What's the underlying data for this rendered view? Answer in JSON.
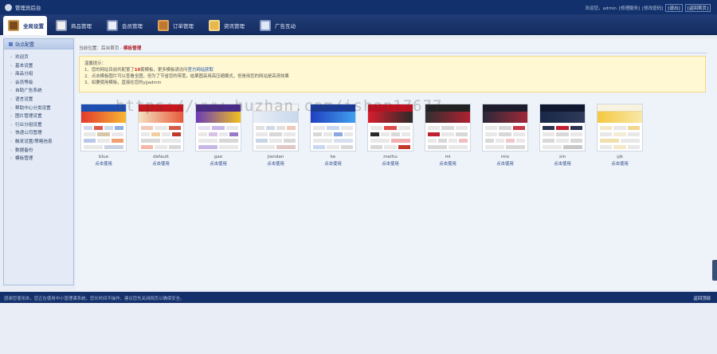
{
  "header": {
    "title": "管理员后台",
    "links": [
      "欢迎您，admin",
      "[修理服务]",
      "[修改密码]",
      "[退出]",
      "[返回首页]"
    ]
  },
  "nav": {
    "tabs": [
      {
        "label": "全局设置",
        "icon": "settings-icon",
        "active": true
      },
      {
        "label": "商品管理",
        "icon": "goods-icon",
        "active": false
      },
      {
        "label": "会员管理",
        "icon": "members-icon",
        "active": false
      },
      {
        "label": "订单管理",
        "icon": "orders-icon",
        "active": false
      },
      {
        "label": "资讯管理",
        "icon": "news-icon",
        "active": false
      },
      {
        "label": "广告互动",
        "icon": "ads-icon",
        "active": false
      }
    ]
  },
  "sidebar": {
    "title": "站点配置",
    "items": [
      "欢迎页",
      "基本设置",
      "商品分组",
      "会员等级",
      "自助广告系统",
      "语言设置",
      "帮助中心分类设置",
      "图片管理设置",
      "行业分组设置",
      "快递公司管理",
      "触发设置/策略信息",
      "数据备份",
      "模板管理"
    ]
  },
  "main": {
    "breadcrumb": {
      "prefix": "当前位置：后台首页 -",
      "current": "模板管理"
    },
    "tips": {
      "title": "温馨提示：",
      "line1_a": "1、您的网站目前共配置了",
      "line1_count": "10",
      "line1_b": "套模板，更多模板请访问",
      "line1_link": "官方网站获取",
      "line2": "2、点击模板图片可以查看全图，但为了节省您的带宽，结果图采用高压缩模式，但是用您的网站是高清效果",
      "line3": "3、如要使用模板，直接在您的yjjadmin"
    },
    "watermark": "https://www.huzhan.com/ishop17677",
    "themes": [
      {
        "name": "blue",
        "action": "点击使用"
      },
      {
        "name": "default",
        "action": "点击使用"
      },
      {
        "name": "gao",
        "action": "点击使用"
      },
      {
        "name": "jiandan",
        "action": "点击使用"
      },
      {
        "name": "ke",
        "action": "点击使用"
      },
      {
        "name": "meihu",
        "action": "点击使用"
      },
      {
        "name": "mi",
        "action": "点击使用"
      },
      {
        "name": "mix",
        "action": "点击使用"
      },
      {
        "name": "xin",
        "action": "点击使用"
      },
      {
        "name": "yjk",
        "action": "点击使用"
      }
    ]
  },
  "footer": {
    "message": "感谢您使用本，您正在使用中小管理课系统，您长时间不操作，建议您先关闭网页以确保安全。",
    "top_link": "返回顶部"
  },
  "colors": {
    "header_bg": "#12306b",
    "tips_bg": "#fff8d2",
    "accent_red": "#d21f1f"
  }
}
